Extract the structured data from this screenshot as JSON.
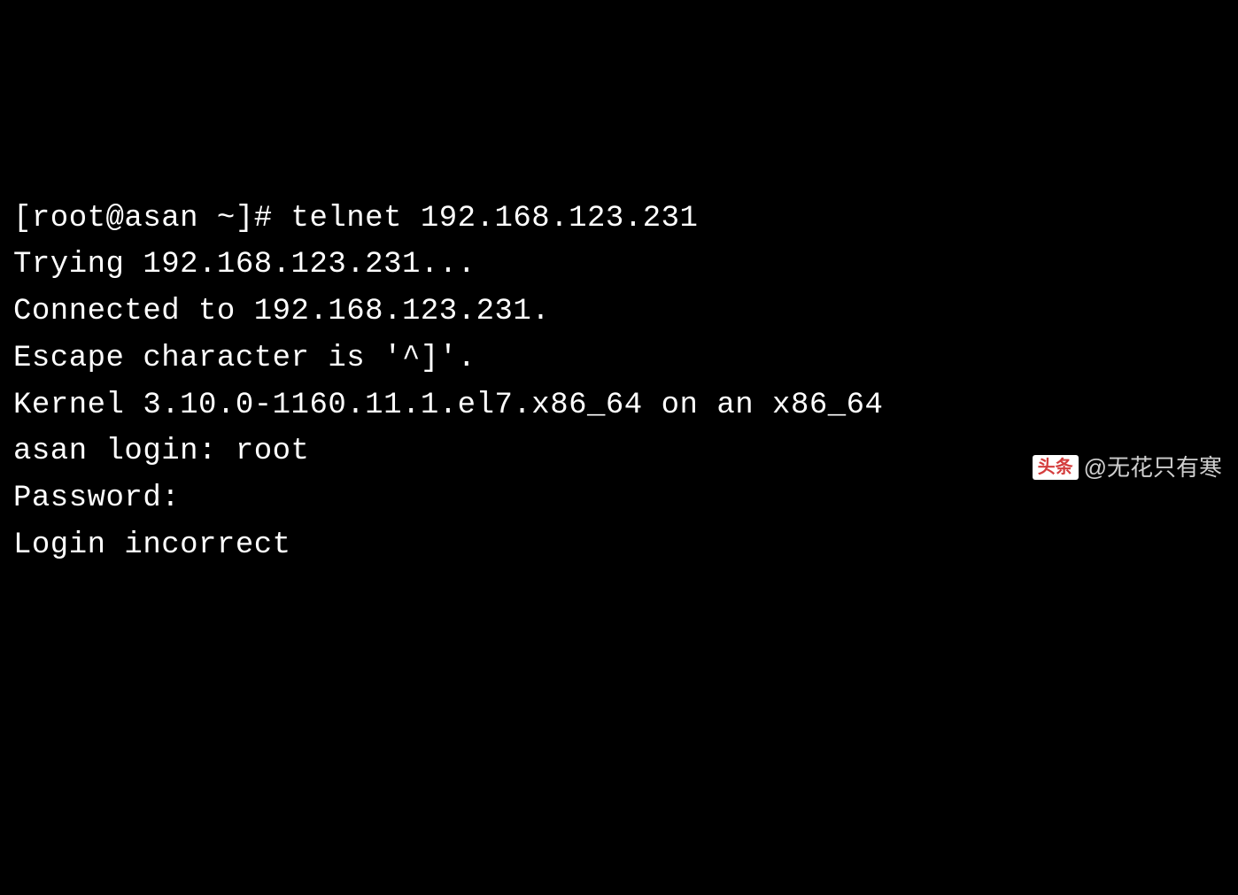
{
  "terminal": {
    "lines": [
      "[root@asan ~]# telnet 192.168.123.231",
      "Trying 192.168.123.231...",
      "Connected to 192.168.123.231.",
      "Escape character is '^]'.",
      "",
      "Kernel 3.10.0-1160.11.1.el7.x86_64 on an x86_64",
      "asan login: root",
      "Password:",
      "Login incorrect"
    ]
  },
  "watermark": {
    "logo": "头条",
    "author": "@无花只有寒"
  }
}
